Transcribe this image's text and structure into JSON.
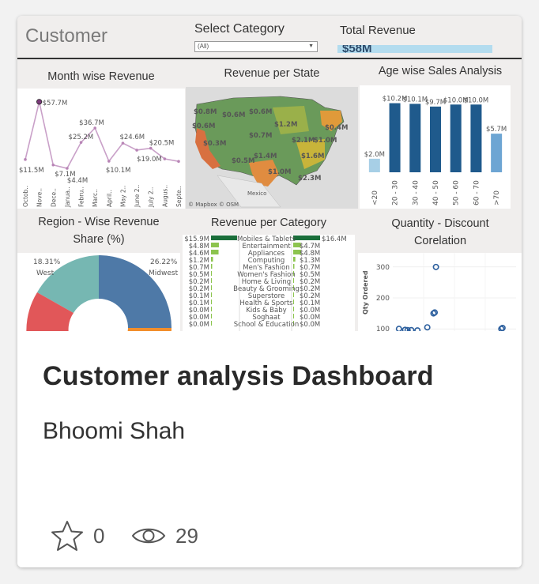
{
  "thumbnail": {
    "title": "Customer",
    "select_label": "Select Category",
    "select_value": "(All)",
    "total_label": "Total Revenue",
    "total_value": "$58M",
    "panels": {
      "month": {
        "title": "Month wise Revenue"
      },
      "state": {
        "title": "Revenue per State",
        "labels": [
          "$0.8M",
          "$0.6M",
          "$0.6M",
          "$0.6M",
          "$1.2M",
          "$0.4M",
          "$0.3M",
          "$0.7M",
          "$2.1M",
          "$1.0M",
          "$1.6M",
          "$0.5M",
          "$1.4M",
          "$1.0M",
          "$2.3M"
        ],
        "attribution": "© Mapbox © OSM",
        "place": "Mexico"
      },
      "age": {
        "title": "Age wise Sales Analysis"
      },
      "region": {
        "title_line1": "Region - Wise Revenue",
        "title_line2": "Share (%)",
        "west_pct": "18.31%",
        "west_label": "West",
        "midwest_pct": "26.22%",
        "midwest_label": "Midwest"
      },
      "category": {
        "title": "Revenue per Category"
      },
      "qty": {
        "title_line1": "Quantity - Discount",
        "title_line2": "Corelation",
        "ylabel": "Qty Ordered",
        "yticks": [
          "300",
          "200",
          "100"
        ]
      }
    }
  },
  "chart_data": [
    {
      "type": "line",
      "title": "Month wise Revenue",
      "categories": [
        "Octob..",
        "Nove..",
        "Dece..",
        "Janua..",
        "Febru..",
        "Marc..",
        "April..",
        "May 2..",
        "June 2..",
        "July 2..",
        "Augus..",
        "Septe.."
      ],
      "values": [
        11.5,
        57.7,
        7.1,
        4.4,
        25.2,
        36.7,
        10.1,
        24.6,
        19.0,
        20.5,
        12.0,
        10.0
      ],
      "labels": [
        "$11.5M",
        "$57.7M",
        "$7.1M",
        "$4.4M",
        "$25.2M",
        "$36.7M",
        "$10.1M",
        "$24.6M",
        "$19.0M",
        "$20.5M"
      ],
      "ylim": [
        0,
        62
      ]
    },
    {
      "type": "bar",
      "title": "Age wise Sales Analysis",
      "categories": [
        "<20",
        "20 - 30",
        "30 - 40",
        "40 - 50",
        "50 - 60",
        "60 - 70",
        ">70"
      ],
      "values": [
        2.0,
        10.2,
        10.1,
        9.7,
        10.0,
        10.0,
        5.7
      ],
      "labels": [
        "$2.0M",
        "$10.2M",
        "$10.1M",
        "$9.7M",
        "$10.0M",
        "$10.0M",
        "$5.7M"
      ],
      "ylim": [
        0,
        10.5
      ]
    },
    {
      "type": "pie",
      "title": "Region - Wise Revenue Share (%)",
      "categories": [
        "West",
        "Midwest"
      ],
      "values": [
        18.31,
        26.22
      ]
    },
    {
      "type": "bar",
      "title": "Revenue per Category",
      "categories": [
        "Mobiles & Tablets",
        "Entertainment",
        "Appliances",
        "Computing",
        "Men's Fashion",
        "Women's Fashion",
        "Home & Living",
        "Beauty & Grooming",
        "Superstore",
        "Health & Sports",
        "Kids & Baby",
        "Soghaat",
        "School & Education"
      ],
      "series": [
        {
          "labels": [
            "$15.9M",
            "$4.8M",
            "$4.6M",
            "$1.2M",
            "$0.7M",
            "$0.5M",
            "$0.2M",
            "$0.2M",
            "$0.1M",
            "$0.1M",
            "$0.0M",
            "$0.0M",
            "$0.0M"
          ],
          "values": [
            15.9,
            4.8,
            4.6,
            1.2,
            0.7,
            0.5,
            0.2,
            0.2,
            0.1,
            0.1,
            0.0,
            0.0,
            0.0
          ]
        },
        {
          "labels": [
            "$16.4M",
            "$4.7M",
            "$4.8M",
            "$1.3M",
            "$0.7M",
            "$0.5M",
            "$0.2M",
            "$0.2M",
            "$0.2M",
            "$0.1M",
            "$0.0M",
            "$0.0M",
            "$0.0M"
          ],
          "values": [
            16.4,
            4.7,
            4.8,
            1.3,
            0.7,
            0.5,
            0.2,
            0.2,
            0.2,
            0.1,
            0.0,
            0.0,
            0.0
          ]
        }
      ]
    },
    {
      "type": "scatter",
      "title": "Quantity - Discount Corelation",
      "ylabel": "Qty Ordered",
      "ylim": [
        80,
        320
      ],
      "points": [
        [
          0.05,
          100
        ],
        [
          0.1,
          97
        ],
        [
          0.12,
          96
        ],
        [
          0.15,
          96
        ],
        [
          0.2,
          95
        ],
        [
          0.28,
          105
        ],
        [
          0.33,
          150
        ],
        [
          0.34,
          153
        ],
        [
          0.35,
          300
        ],
        [
          0.88,
          100
        ],
        [
          0.89,
          103
        ]
      ]
    }
  ],
  "card": {
    "title": "Customer analysis Dashboard",
    "author": "Bhoomi Shah",
    "favorites": "0",
    "views": "29"
  }
}
